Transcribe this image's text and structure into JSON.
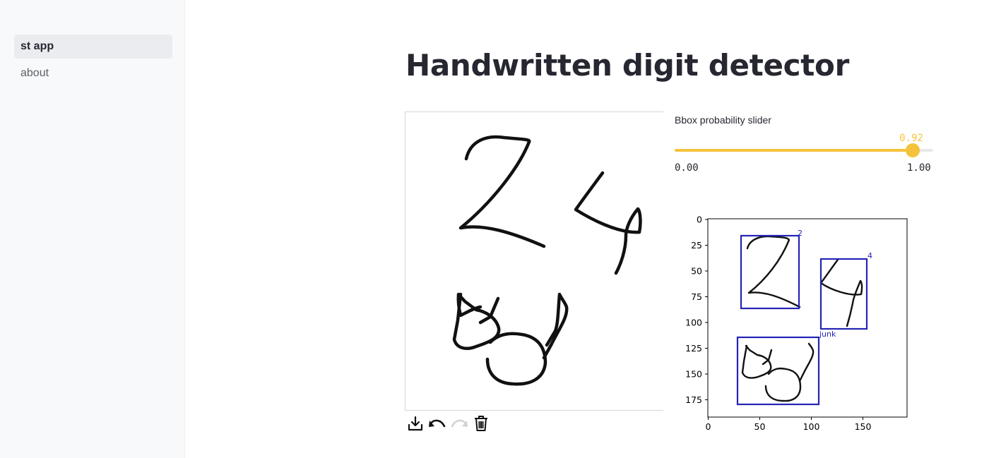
{
  "sidebar": {
    "items": [
      {
        "label": "st app",
        "active": true
      },
      {
        "label": "about",
        "active": false
      }
    ]
  },
  "main": {
    "title": "Handwritten digit detector"
  },
  "canvas": {
    "toolbar": [
      {
        "icon": "download-icon"
      },
      {
        "icon": "undo-icon"
      },
      {
        "icon": "redo-icon"
      },
      {
        "icon": "trash-icon"
      }
    ]
  },
  "slider": {
    "label": "Bbox probability slider",
    "value": 0.92,
    "value_text": "0.92",
    "min": 0.0,
    "max": 1.0,
    "min_text": "0.00",
    "max_text": "1.00",
    "color": "#f5c33b"
  },
  "plot": {
    "x_ticks": [
      "0",
      "50",
      "100",
      "150"
    ],
    "y_ticks": [
      "0",
      "25",
      "50",
      "75",
      "100",
      "125",
      "150",
      "175"
    ],
    "box_color": "#2424b6",
    "boxes": [
      {
        "label": "2"
      },
      {
        "label": "4"
      },
      {
        "label": "junk"
      }
    ]
  }
}
